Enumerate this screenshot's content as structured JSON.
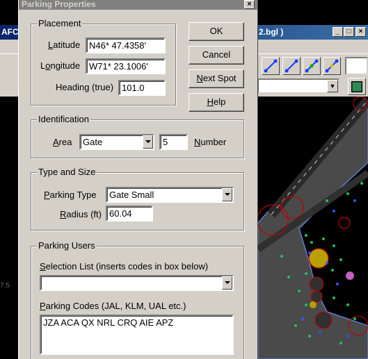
{
  "background_app": {
    "title_left": "AFC",
    "title_right": "2.bgl )",
    "scale_label": "7.5"
  },
  "dialog": {
    "title": "Parking Properties",
    "close_label": "×",
    "placement": {
      "legend": "Placement",
      "latitude_label": "Latitude",
      "latitude_value": "N46* 47.4358'",
      "longitude_label": "Longitude",
      "longitude_value": "W71* 23.1006'",
      "heading_label": "Heading (true)",
      "heading_value": "101.0"
    },
    "buttons": {
      "ok": "OK",
      "cancel": "Cancel",
      "next_spot": "Next Spot",
      "help": "Help"
    },
    "identification": {
      "legend": "Identification",
      "area_label": "Area",
      "area_value": "Gate",
      "number_value": "5",
      "number_label": "Number"
    },
    "type_size": {
      "legend": "Type and Size",
      "parking_type_label": "Parking Type",
      "parking_type_value": "Gate Small",
      "radius_label": "Radius (ft)",
      "radius_value": "60.04"
    },
    "parking_users": {
      "legend": "Parking Users",
      "selection_label": "Selection List  (inserts codes in box below)",
      "selection_value": "",
      "codes_label": "Parking Codes (JAL, KLM, UAL etc.)",
      "codes_value": "JZA ACA QX NRL CRQ AIE APZ"
    }
  }
}
